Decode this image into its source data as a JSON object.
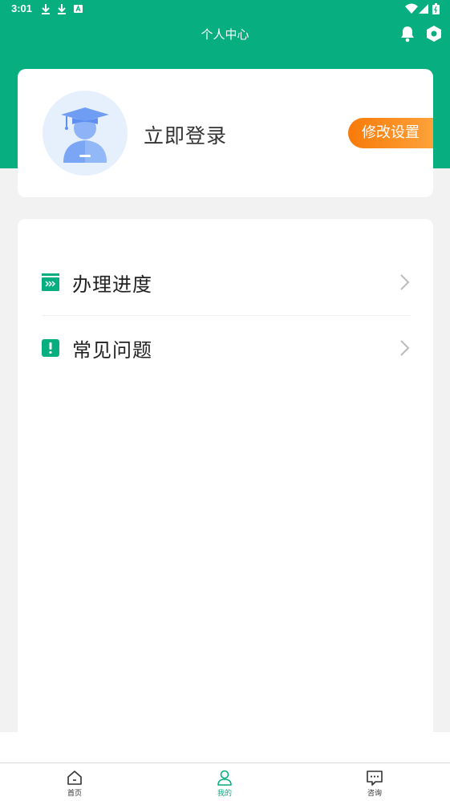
{
  "status_bar": {
    "time": "3:01",
    "icons": [
      "download-icon",
      "download-icon",
      "font-icon",
      "wifi-icon",
      "signal-icon",
      "battery-icon"
    ]
  },
  "header": {
    "title": "个人中心",
    "icons": [
      "bell-icon",
      "settings-hex-icon"
    ]
  },
  "profile": {
    "login_label": "立即登录",
    "settings_button": "修改设置",
    "avatar_icon": "student-avatar-icon"
  },
  "menu": {
    "items": [
      {
        "label": "办理进度",
        "icon": "progress-icon"
      },
      {
        "label": "常见问题",
        "icon": "faq-icon"
      }
    ]
  },
  "bottom_nav": {
    "items": [
      {
        "label": "首页",
        "icon": "home-icon"
      },
      {
        "label": "我的",
        "icon": "user-icon",
        "active": true
      },
      {
        "label": "咨询",
        "icon": "chat-icon"
      }
    ]
  },
  "colors": {
    "brand_green": "#07ae7f",
    "accent_orange": "#f87a0a",
    "avatar_bg": "#e6f0fd"
  }
}
